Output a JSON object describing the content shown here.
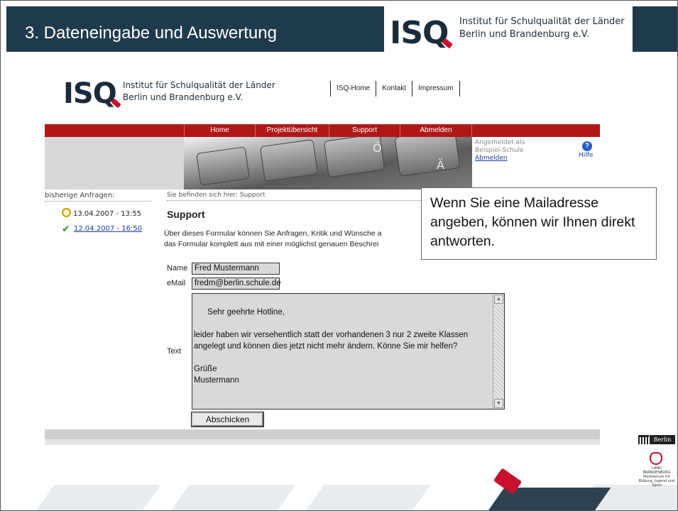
{
  "slide": {
    "title": "3.  Dateneingabe und Auswertung",
    "logo_letters": "ISQ",
    "logo_line1": "Institut für Schulqualität der Länder",
    "logo_line2": "Berlin und Brandenburg e.V."
  },
  "site": {
    "logo_letters": "ISQ",
    "logo_line1": "Institut für Schulqualität der Länder",
    "logo_line2": "Berlin und Brandenburg e.V.",
    "top_links": [
      "ISQ-Home",
      "Kontakt",
      "Impressum"
    ],
    "nav": [
      "Home",
      "Projektübersicht",
      "Support",
      "Abmelden"
    ],
    "login": {
      "line1": "Angemeldet als",
      "line2": "Beispiel-Schule",
      "logout": "Abmelden",
      "help_label": "Hilfe",
      "help_icon_glyph": "?"
    },
    "keyboard_keys": [
      "Ö",
      "Ä"
    ]
  },
  "sidebar": {
    "label": "bisherige Anfragen:",
    "requests": [
      {
        "text": "13.04.2007 - 13:55",
        "icon": "clock-icon"
      },
      {
        "text": "12.04.2007 - 16:50",
        "icon": "checkmark-icon",
        "glyph": "✔"
      }
    ]
  },
  "main": {
    "breadcrumb": "Sie befinden sich hier: Support",
    "title": "Support",
    "intro_line1": "Über dieses Formular können Sie Anfragen, Kritik und Wünsche a",
    "intro_line2": "das Formular komplett aus mit einer möglichst genauen Beschrei",
    "form": {
      "name_label": "Name",
      "name_value": "Fred Mustermann",
      "email_label": "eMail",
      "email_value": "fredm@berlin.schule.de",
      "text_label": "Text",
      "text_value": "Sehr geehrte Hotline,\n\nleider haben wir versehentlich statt der vorhandenen 3 nur 2 zweite Klassen angelegt und können dies jetzt nicht mehr ändern. Könne Sie mir helfen?\n\nGrüße\nMustermann",
      "submit_label": "Abschicken"
    }
  },
  "callout": {
    "text": "Wenn Sie eine Mailadresse angeben, können wir Ihnen direkt antworten."
  },
  "footer_logos": {
    "berlin": "Berlin",
    "brandenburg_line1": "LAND",
    "brandenburg_line2": "BRANDENBURG",
    "brandenburg_line3": "Ministerium für Bildung, Jugend und Sport"
  },
  "colors": {
    "header_bar": "#1f3a4d",
    "nav_red": "#b01818",
    "logo_red": "#c8102e",
    "link_blue": "#1a3d8f"
  }
}
